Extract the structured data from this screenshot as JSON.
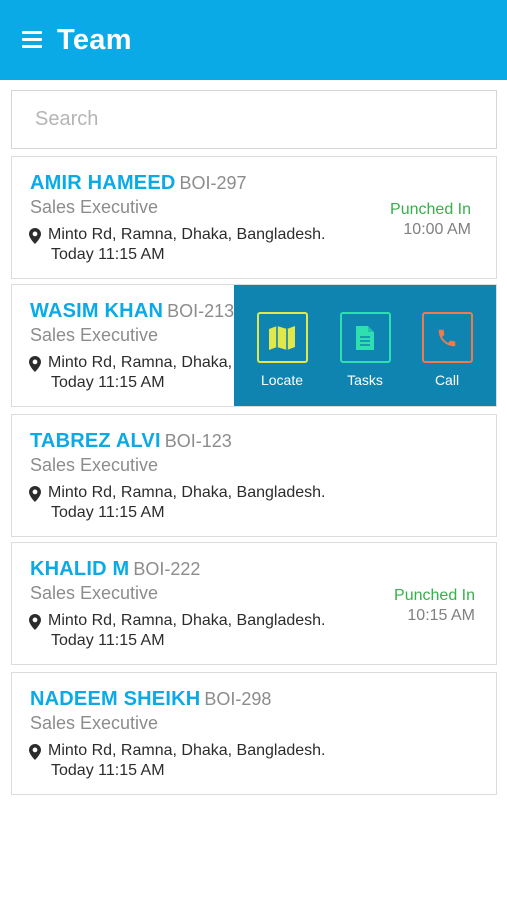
{
  "app": {
    "title": "Team"
  },
  "search": {
    "placeholder": "Search"
  },
  "employees": [
    {
      "name": "AMIR HAMEED",
      "id": "BOI-297",
      "role": "Sales Executive",
      "address": "Minto Rd, Ramna, Dhaka, Bangladesh.",
      "time": "Today 11:15 AM",
      "status": "Punched In",
      "status_time": "10:00 AM"
    },
    {
      "name": "WASIM KHAN",
      "id": "BOI-213",
      "role": "Sales Executive",
      "address": "Minto Rd, Ramna, Dhaka, Bangladesh.",
      "time": "Today 11:15 AM"
    },
    {
      "name": "TABREZ ALVI",
      "id": "BOI-123",
      "role": "Sales Executive",
      "address": "Minto Rd, Ramna, Dhaka, Bangladesh.",
      "time": "Today 11:15 AM"
    },
    {
      "name": "KHALID M",
      "id": "BOI-222",
      "role": "Sales Executive",
      "address": "Minto Rd, Ramna, Dhaka, Bangladesh.",
      "time": "Today 11:15 AM",
      "status": "Punched In",
      "status_time": "10:15 AM"
    },
    {
      "name": "NADEEM SHEIKH",
      "id": "BOI-298",
      "role": "Sales Executive",
      "address": "Minto Rd, Ramna, Dhaka, Bangladesh.",
      "time": "Today 11:15 AM"
    }
  ],
  "actions": [
    {
      "label": "Locate",
      "icon": "map-icon",
      "color": "#e3e84a"
    },
    {
      "label": "Tasks",
      "icon": "document-icon",
      "color": "#2ee0b0"
    },
    {
      "label": "Call",
      "icon": "phone-icon",
      "color": "#f07a4a"
    }
  ],
  "colors": {
    "appbar": "#0aaae6",
    "name": "#0aaae6",
    "punched_in": "#36b04a",
    "action_panel": "#0f84b0"
  }
}
